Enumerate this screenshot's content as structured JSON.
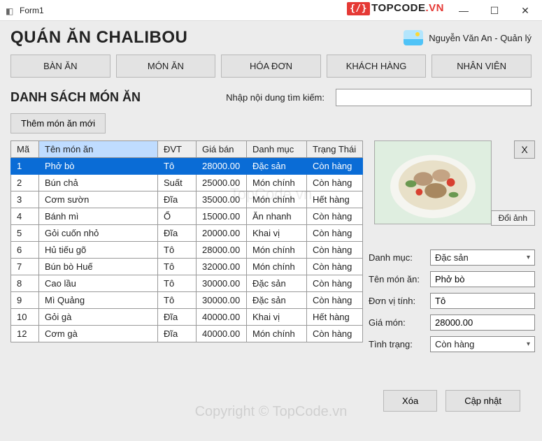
{
  "window": {
    "title": "Form1"
  },
  "brand": {
    "prefix": "{/}",
    "name": "TOPCODE",
    "tld": ".VN"
  },
  "header": {
    "title": "QUÁN ĂN CHALIBOU",
    "user": "Nguyễn Văn An - Quản lý"
  },
  "nav": [
    "BÀN ĂN",
    "MÓN ĂN",
    "HÓA ĐƠN",
    "KHÁCH HÀNG",
    "NHÂN VIÊN"
  ],
  "list": {
    "title": "DANH SÁCH MÓN ĂN",
    "search_label": "Nhập nội dung tìm kiếm:",
    "search_value": "",
    "add_button": "Thêm món ăn mới"
  },
  "table": {
    "headers": [
      "Mã",
      "Tên món ăn",
      "ĐVT",
      "Giá bán",
      "Danh mục",
      "Trạng Thái"
    ],
    "sorted_col": 1,
    "selected_row": 0,
    "rows": [
      [
        "1",
        "Phở bò",
        "Tô",
        "28000.00",
        "Đặc sản",
        "Còn hàng"
      ],
      [
        "2",
        "Bún chả",
        "Suất",
        "25000.00",
        "Món chính",
        "Còn hàng"
      ],
      [
        "3",
        "Cơm sườn",
        "Đĩa",
        "35000.00",
        "Món chính",
        "Hết hàng"
      ],
      [
        "4",
        "Bánh mì",
        "Ổ",
        "15000.00",
        "Ăn nhanh",
        "Còn hàng"
      ],
      [
        "5",
        "Gỏi cuốn nhỏ",
        "Đĩa",
        "20000.00",
        "Khai vị",
        "Còn hàng"
      ],
      [
        "6",
        "Hủ tiếu gõ",
        "Tô",
        "28000.00",
        "Món chính",
        "Còn hàng"
      ],
      [
        "7",
        "Bún bò Huế",
        "Tô",
        "32000.00",
        "Món chính",
        "Còn hàng"
      ],
      [
        "8",
        "Cao lầu",
        "Tô",
        "30000.00",
        "Đặc sản",
        "Còn hàng"
      ],
      [
        "9",
        "Mì Quảng",
        "Tô",
        "30000.00",
        "Đặc sản",
        "Còn hàng"
      ],
      [
        "10",
        "Gỏi gà",
        "Đĩa",
        "40000.00",
        "Khai vị",
        "Hết hàng"
      ],
      [
        "12",
        "Cơm gà",
        "Đĩa",
        "40000.00",
        "Món chính",
        "Còn hàng"
      ]
    ]
  },
  "detail": {
    "close": "X",
    "change_image": "Đổi ảnh",
    "fields": {
      "category_label": "Danh mục:",
      "category_value": "Đặc sản",
      "name_label": "Tên món ăn:",
      "name_value": "Phở bò",
      "unit_label": "Đơn vị tính:",
      "unit_value": "Tô",
      "price_label": "Giá món:",
      "price_value": "28000.00",
      "status_label": "Tình trạng:",
      "status_value": "Còn hàng"
    },
    "delete": "Xóa",
    "update": "Cập nhật"
  },
  "watermark": "TopCode.vn",
  "copyright": "Copyright © TopCode.vn"
}
